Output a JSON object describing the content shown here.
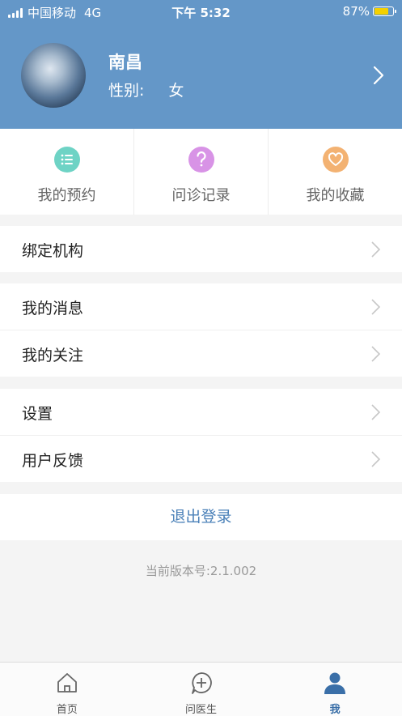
{
  "status_bar": {
    "carrier": "中国移动",
    "network": "4G",
    "time": "下午 5:32",
    "battery": "87%"
  },
  "profile": {
    "name": "南昌",
    "gender_label": "性别:",
    "gender_value": "女"
  },
  "quick_actions": [
    {
      "label": "我的预约",
      "icon": "list-icon",
      "color": "#6ed3c5"
    },
    {
      "label": "问诊记录",
      "icon": "question-icon",
      "color": "#d893e6"
    },
    {
      "label": "我的收藏",
      "icon": "heart-icon",
      "color": "#f3b272"
    }
  ],
  "menu": {
    "group1": [
      {
        "label": "绑定机构"
      }
    ],
    "group2": [
      {
        "label": "我的消息"
      },
      {
        "label": "我的关注"
      }
    ],
    "group3": [
      {
        "label": "设置"
      },
      {
        "label": "用户反馈"
      }
    ]
  },
  "logout_label": "退出登录",
  "version_text": "当前版本号:2.1.002",
  "tabbar": [
    {
      "label": "首页",
      "icon": "home-icon",
      "active": false
    },
    {
      "label": "问医生",
      "icon": "ask-doctor-icon",
      "active": false
    },
    {
      "label": "我",
      "icon": "user-icon",
      "active": true
    }
  ],
  "colors": {
    "header": "#6497c8",
    "accent": "#4a80b8",
    "active_tab": "#3a6fa8"
  }
}
